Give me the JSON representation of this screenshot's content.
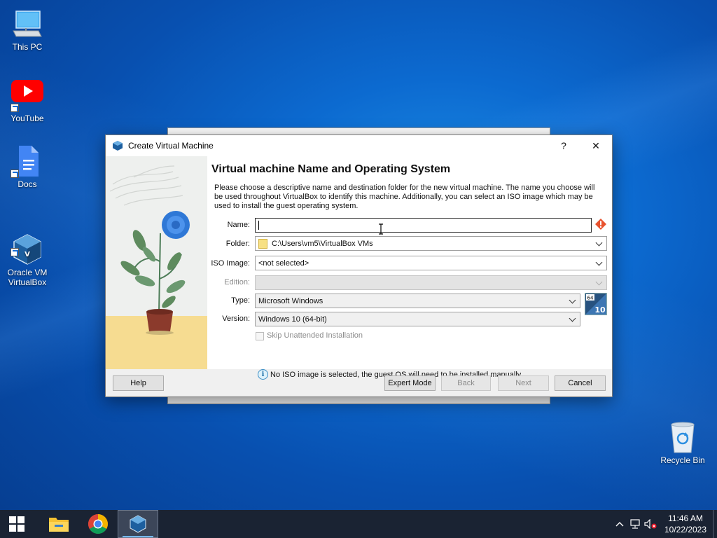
{
  "desktop": {
    "icons": [
      {
        "label": "This PC",
        "icon": "computer-icon"
      },
      {
        "label": "YouTube",
        "icon": "youtube-icon"
      },
      {
        "label": "Docs",
        "icon": "docs-icon"
      },
      {
        "label": "Oracle VM\nVirtualBox",
        "icon": "virtualbox-icon"
      }
    ],
    "recycle_bin": {
      "label": "Recycle Bin",
      "icon": "recycle-bin-icon"
    }
  },
  "dialog": {
    "title": "Create Virtual Machine",
    "help_glyph": "?",
    "close_glyph": "✕",
    "heading": "Virtual machine Name and Operating System",
    "description": "Please choose a descriptive name and destination folder for the new virtual machine. The name you choose will be used throughout VirtualBox to identify this machine. Additionally, you can select an ISO image which may be used to install the guest operating system.",
    "fields": {
      "name": {
        "label": "Name:",
        "value": ""
      },
      "folder": {
        "label": "Folder:",
        "value": "C:\\Users\\vm5\\VirtualBox VMs"
      },
      "iso": {
        "label": "ISO Image:",
        "value": "<not selected>"
      },
      "edition": {
        "label": "Edition:",
        "value": ""
      },
      "type": {
        "label": "Type:",
        "value": "Microsoft Windows"
      },
      "version": {
        "label": "Version:",
        "value": "Windows 10 (64-bit)"
      }
    },
    "os_badge": {
      "bits": "64",
      "version": "10"
    },
    "skip_unattended": {
      "label": "Skip Unattended Installation",
      "checked": false,
      "enabled": false
    },
    "info_message": "No ISO image is selected, the guest OS will need to be installed manually.",
    "buttons": {
      "help": "Help",
      "expert": "Expert Mode",
      "back": "Back",
      "next": "Next",
      "cancel": "Cancel"
    }
  },
  "taskbar": {
    "apps": [
      "start-icon",
      "file-explorer-icon",
      "chrome-icon",
      "virtualbox-icon"
    ],
    "active_app": "virtualbox-icon",
    "clock": {
      "time": "11:46 AM",
      "date": "10/22/2023"
    }
  },
  "colors": {
    "accent": "#0c6ad0",
    "taskbar": "#1a2333",
    "warning": "#e8532f"
  }
}
